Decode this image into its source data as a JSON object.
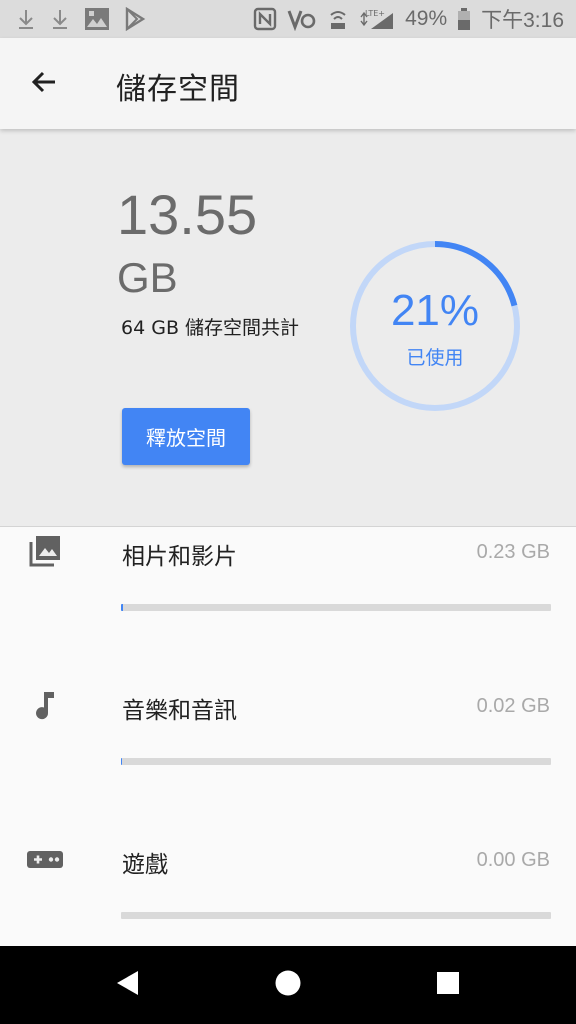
{
  "status_bar": {
    "battery_percent": "49%",
    "time": "下午3:16",
    "icons": [
      "download-icon",
      "download-icon",
      "gallery-icon",
      "play-store-icon",
      "nfc-icon",
      "volte-icon",
      "wifi-icon",
      "lte-signal-icon",
      "battery-icon"
    ]
  },
  "app_bar": {
    "title": "儲存空間",
    "back_icon": "arrow-back-icon"
  },
  "summary": {
    "used_value": "13.55",
    "used_unit": "GB",
    "total_text": "64 GB 儲存空間共計",
    "free_button_label": "釋放空間",
    "percent_label": "21%",
    "percent_value": 0.21,
    "used_label": "已使用"
  },
  "categories": [
    {
      "icon": "photo-library-icon",
      "label": "相片和影片",
      "size": "0.23 GB",
      "fraction": 0.0036
    },
    {
      "icon": "music-note-icon",
      "label": "音樂和音訊",
      "size": "0.02 GB",
      "fraction": 0.0003
    },
    {
      "icon": "gamepad-icon",
      "label": "遊戲",
      "size": "0.00 GB",
      "fraction": 0.0
    }
  ],
  "colors": {
    "accent": "#4285f4",
    "gauge_track": "#c2d7f8",
    "summary_bg": "#ececec",
    "nav_bg": "#000000"
  },
  "nav_bar": {
    "icons": [
      "back-triangle-icon",
      "home-circle-icon",
      "recents-square-icon"
    ]
  }
}
